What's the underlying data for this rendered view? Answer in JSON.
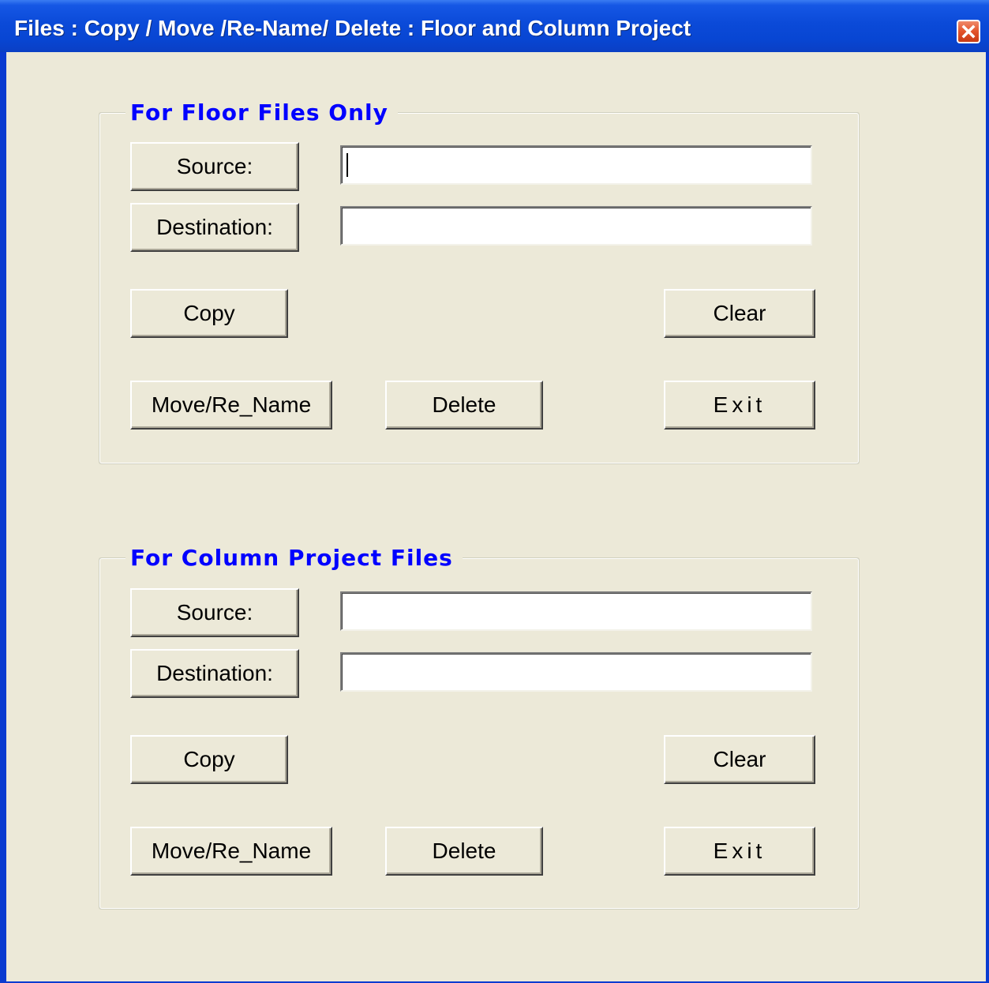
{
  "window": {
    "title": "Files : Copy / Move /Re-Name/ Delete : Floor and Column Project",
    "close_icon": "close-icon",
    "close_color": "#e2532a",
    "titlebar_color": "#0846d3",
    "body_color": "#ece9d8"
  },
  "floor_group": {
    "legend": "For Floor Files Only",
    "source_label": "Source:",
    "source_value": "",
    "destination_label": "Destination:",
    "destination_value": "",
    "copy_label": "Copy",
    "clear_label": "Clear",
    "move_label": "Move/Re_Name",
    "delete_label": "Delete",
    "exit_label": "Exit"
  },
  "column_group": {
    "legend": "For Column Project Files",
    "source_label": "Source:",
    "source_value": "",
    "destination_label": "Destination:",
    "destination_value": "",
    "copy_label": "Copy",
    "clear_label": "Clear",
    "move_label": "Move/Re_Name",
    "delete_label": "Delete",
    "exit_label": "Exit"
  },
  "legend_color": "#0000ff"
}
